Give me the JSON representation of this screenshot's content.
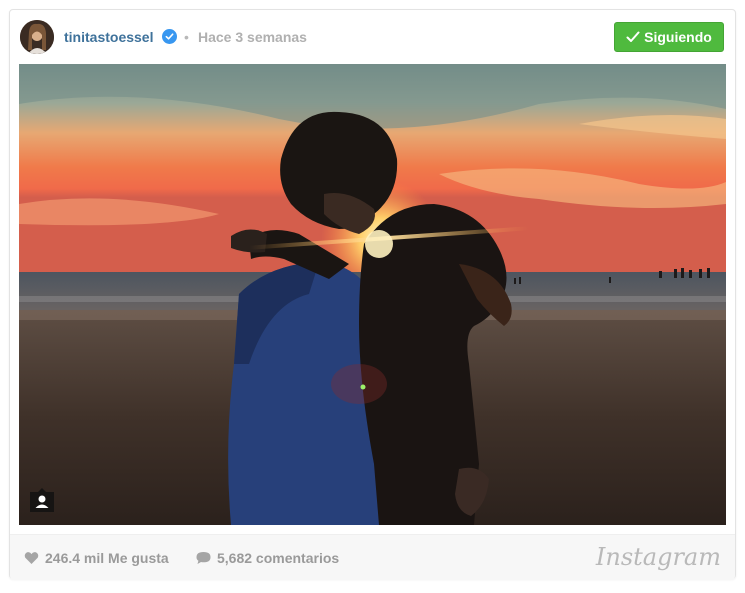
{
  "post": {
    "username": "tinitastoessel",
    "separator": "•",
    "timestamp": "Hace 3 semanas",
    "follow_label": "Siguiendo",
    "likes_text": "246.4 mil Me gusta",
    "comments_text": "5,682 comentarios",
    "brand_text": "Instagram"
  },
  "colors": {
    "username": "#3f729b",
    "follow_button": "#4fba3e",
    "verified_badge": "#3897f0"
  },
  "icons": {
    "verified": "verified-badge-icon",
    "follow_check": "check-icon",
    "heart": "heart-icon",
    "comment": "comment-bubble-icon",
    "user_tag": "user-tag-icon"
  }
}
